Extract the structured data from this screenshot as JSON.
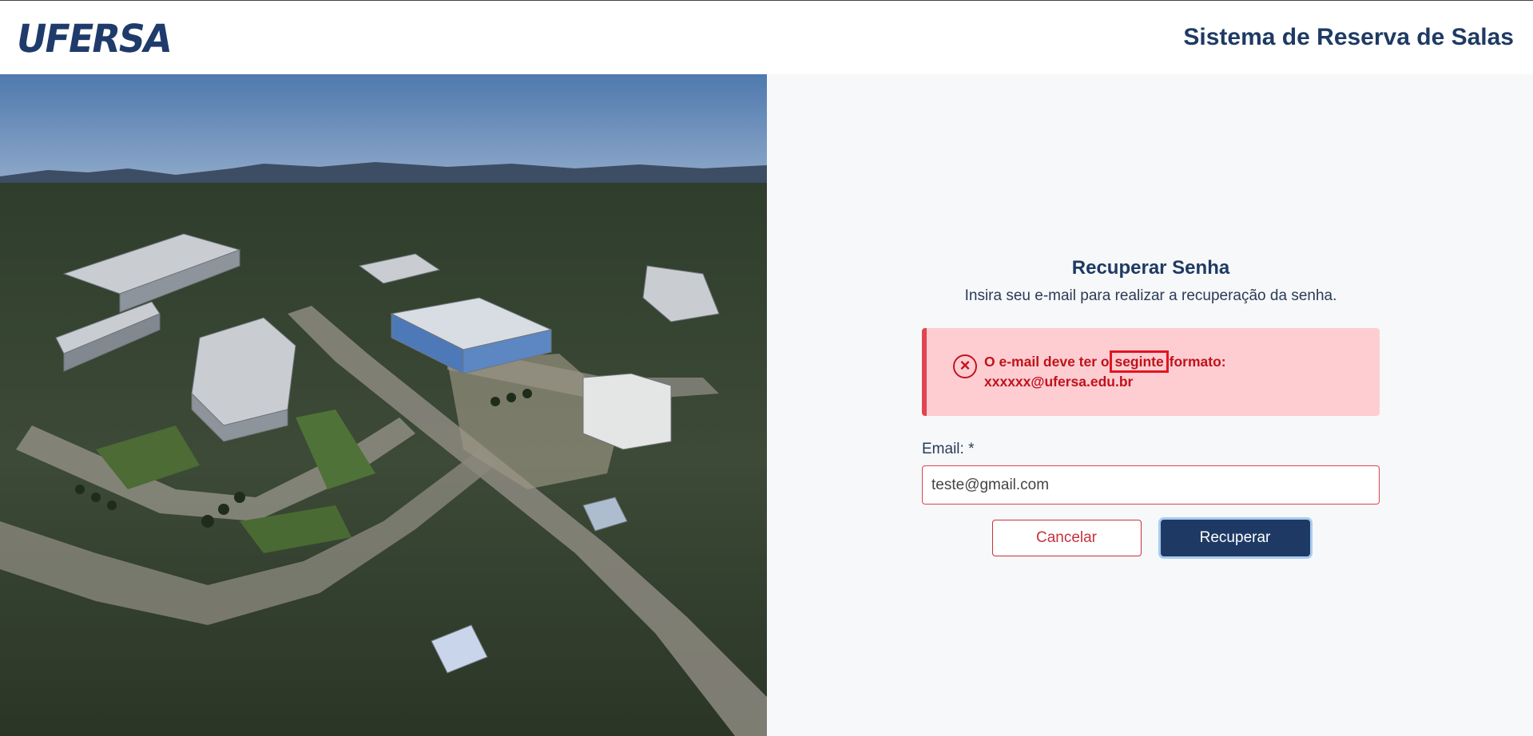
{
  "header": {
    "logo_text": "UFERSA",
    "title": "Sistema de Reserva de Salas"
  },
  "photo": {
    "icon": "campus-aerial-photo"
  },
  "form": {
    "title": "Recuperar Senha",
    "subtitle": "Insira seu e-mail para realizar a recuperação da senha.",
    "alert": {
      "icon": "error-circle-x-icon",
      "text_before": "O e-mail deve ter o",
      "highlighted_word": "seginte",
      "text_after": "formato:",
      "example": "xxxxxx@ufersa.edu.br"
    },
    "email_label": "Email: *",
    "email_value": "teste@gmail.com",
    "cancel_label": "Cancelar",
    "submit_label": "Recuperar"
  },
  "colors": {
    "primary": "#1e3a64",
    "error": "#c0121c",
    "alert_bg": "#fdcdd1",
    "panel_bg": "#f7f8fa"
  }
}
